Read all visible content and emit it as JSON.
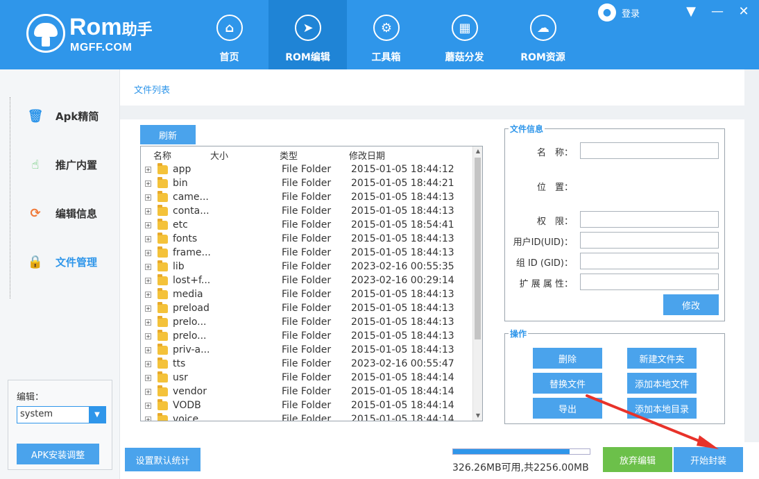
{
  "header": {
    "logo_brand": "Rom",
    "logo_brand_cn": "助手",
    "logo_domain": "MGFF.COM",
    "login_label": "登录",
    "nav": [
      {
        "label": "首页",
        "icon": "home-icon",
        "glyph": "⌂"
      },
      {
        "label": "ROM编辑",
        "icon": "cursor-icon",
        "glyph": "➤"
      },
      {
        "label": "工具箱",
        "icon": "gear-icon",
        "glyph": "⚙"
      },
      {
        "label": "蘑菇分发",
        "icon": "grid-icon",
        "glyph": "▦"
      },
      {
        "label": "ROM资源",
        "icon": "cloud-icon",
        "glyph": "☁"
      }
    ],
    "active_nav": 1
  },
  "sidebar": {
    "items": [
      {
        "label": "Apk精简",
        "icon": "trash-icon",
        "glyph": "🗑",
        "color": "#2f96ea"
      },
      {
        "label": "推广内置",
        "icon": "touch-icon",
        "glyph": "☝",
        "color": "#4cbf5a"
      },
      {
        "label": "编辑信息",
        "icon": "refresh-icon",
        "glyph": "⟳",
        "color": "#f07a3a"
      },
      {
        "label": "文件管理",
        "icon": "lock-icon",
        "glyph": "🔒",
        "color": "#4cbf8a"
      }
    ],
    "active_item": 3,
    "edit_label": "编辑：",
    "edit_value": "system",
    "apk_button": "APK安装调整"
  },
  "main": {
    "title": "文件列表",
    "refresh_button": "刷新",
    "columns": {
      "name": "名称",
      "size": "大小",
      "type": "类型",
      "date": "修改日期"
    },
    "rows": [
      {
        "name": "app",
        "type": "File Folder",
        "date": "2015-01-05 18:44:12"
      },
      {
        "name": "bin",
        "type": "File Folder",
        "date": "2015-01-05 18:44:21"
      },
      {
        "name": "came...",
        "type": "File Folder",
        "date": "2015-01-05 18:44:13"
      },
      {
        "name": "conta...",
        "type": "File Folder",
        "date": "2015-01-05 18:44:13"
      },
      {
        "name": "etc",
        "type": "File Folder",
        "date": "2015-01-05 18:54:41"
      },
      {
        "name": "fonts",
        "type": "File Folder",
        "date": "2015-01-05 18:44:13"
      },
      {
        "name": "frame...",
        "type": "File Folder",
        "date": "2015-01-05 18:44:13"
      },
      {
        "name": "lib",
        "type": "File Folder",
        "date": "2023-02-16 00:55:35"
      },
      {
        "name": "lost+f...",
        "type": "File Folder",
        "date": "2023-02-16 00:29:14"
      },
      {
        "name": "media",
        "type": "File Folder",
        "date": "2015-01-05 18:44:13"
      },
      {
        "name": "preload",
        "type": "File Folder",
        "date": "2015-01-05 18:44:13"
      },
      {
        "name": "prelo...",
        "type": "File Folder",
        "date": "2015-01-05 18:44:13"
      },
      {
        "name": "prelo...",
        "type": "File Folder",
        "date": "2015-01-05 18:44:13"
      },
      {
        "name": "priv-a...",
        "type": "File Folder",
        "date": "2015-01-05 18:44:13"
      },
      {
        "name": "tts",
        "type": "File Folder",
        "date": "2023-02-16 00:55:47"
      },
      {
        "name": "usr",
        "type": "File Folder",
        "date": "2015-01-05 18:44:14"
      },
      {
        "name": "vendor",
        "type": "File Folder",
        "date": "2015-01-05 18:44:14"
      },
      {
        "name": "VODB",
        "type": "File Folder",
        "date": "2015-01-05 18:44:14"
      },
      {
        "name": "voice",
        "type": "File Folder",
        "date": "2015-01-05 18:44:14"
      }
    ],
    "file_info": {
      "legend": "文件信息",
      "fields": [
        {
          "label": "名　称：",
          "has_input": true,
          "value": ""
        },
        {
          "label": "位　置：",
          "has_input": false,
          "value": ""
        },
        {
          "label": "权　限：",
          "has_input": true,
          "value": ""
        },
        {
          "label": "用户ID(UID)：",
          "has_input": true,
          "value": ""
        },
        {
          "label": "组 ID (GID)：",
          "has_input": true,
          "value": ""
        },
        {
          "label": "扩 展 属 性：",
          "has_input": true,
          "value": ""
        }
      ],
      "modify_button": "修改"
    },
    "operations": {
      "legend": "操作",
      "buttons": [
        "删除",
        "新建文件夹",
        "替换文件",
        "添加本地文件",
        "导出",
        "添加本地目录"
      ]
    }
  },
  "bottom": {
    "stats_button": "设置默认统计",
    "storage_fraction": 0.855,
    "storage_text": "326.26MB可用,共2256.00MB",
    "abandon_button": "放弃编辑",
    "package_button": "开始封装"
  },
  "colors": {
    "accent": "#2f96ea",
    "accent_dark": "#1f84d6",
    "green": "#6cc04a",
    "annotation_arrow": "#e8322a"
  }
}
